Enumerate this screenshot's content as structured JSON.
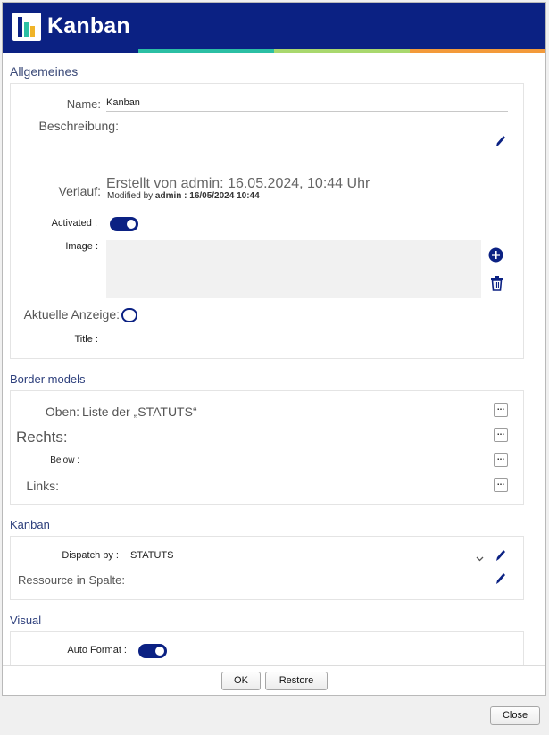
{
  "header": {
    "title": "Kanban",
    "colors": {
      "bar": "#0b2183",
      "stripe": [
        "#0b2183",
        "#2bbfa4",
        "#a9d86e",
        "#f39a3a"
      ],
      "logo": [
        "#0b2183",
        "#2bbfa4",
        "#f0b429"
      ]
    },
    "logo_icon": "kanban-logo-icon"
  },
  "general": {
    "section_title": "Allgemeines",
    "name_label": "Name:",
    "name_value": "Kanban",
    "description_label": "Beschreibung:",
    "history_label": "Verlauf:",
    "history_created": "Erstellt von admin: 16.05.2024, 10:44 Uhr",
    "history_modified_prefix": "Modified by",
    "history_modified_value": "admin : 16/05/2024 10:44",
    "activated_label": "Activated :",
    "activated": true,
    "image_label": "Image :",
    "current_display_label": "Aktuelle Anzeige:",
    "current_display": false,
    "title_label": "Title :",
    "title_value": ""
  },
  "border_models": {
    "section_title": "Border models",
    "top_label": "Oben:",
    "top_value": "Liste der „STATUTS“",
    "right_label": "Rechts:",
    "below_label": "Below :",
    "left_label": "Links:",
    "more_label": "..."
  },
  "kanban": {
    "section_title": "Kanban",
    "dispatch_label": "Dispatch by :",
    "dispatch_value": "STATUTS",
    "resource_label": "Ressource in Spalte:"
  },
  "visual": {
    "section_title": "Visual",
    "auto_format_label": "Auto Format :",
    "auto_format": true
  },
  "buttons": {
    "ok": "OK",
    "restore": "Restore",
    "close": "Close"
  }
}
